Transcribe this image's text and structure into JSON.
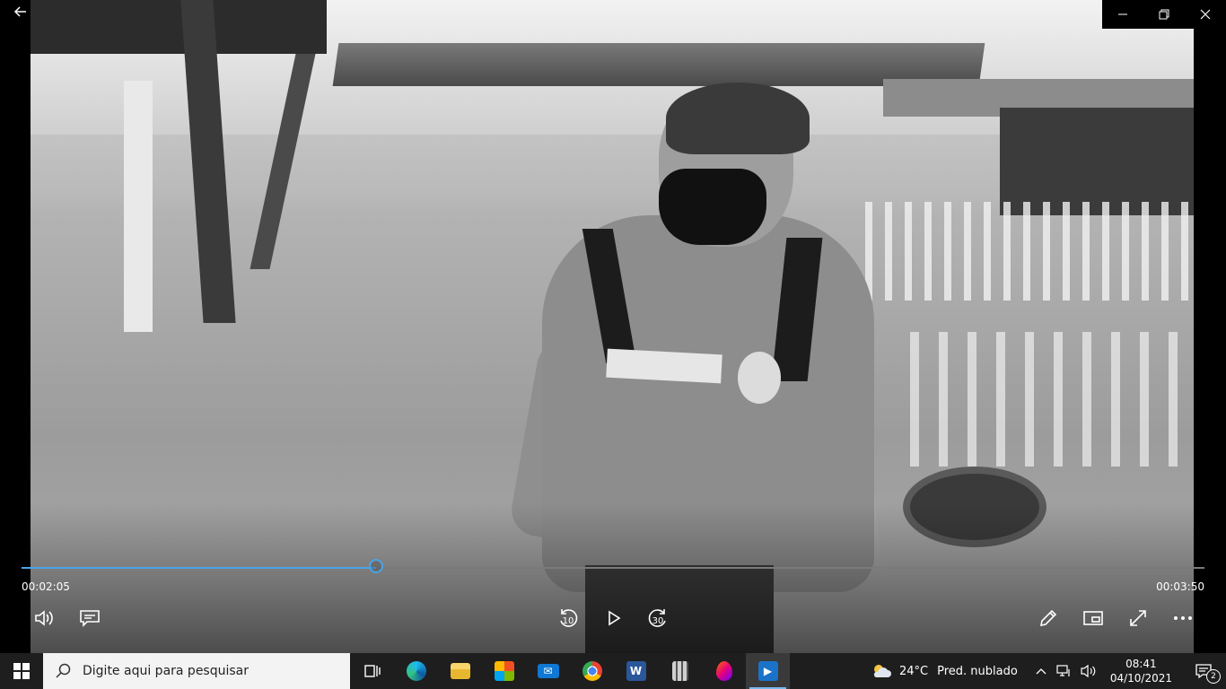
{
  "player": {
    "time_elapsed": "00:02:05",
    "time_total": "00:03:50",
    "progress_fraction": 0.3,
    "skip_back_seconds": "10",
    "skip_forward_seconds": "30",
    "accent_color": "#4aa3e8"
  },
  "window": {
    "icons": [
      "back-arrow-icon",
      "minimize-icon",
      "restore-icon",
      "close-icon"
    ]
  },
  "taskbar": {
    "search_placeholder": "Digite aqui para pesquisar",
    "apps": [
      "task-view",
      "edge",
      "file-explorer",
      "microsoft-store",
      "mail",
      "chrome",
      "word",
      "calculator",
      "paint-3d",
      "movies-and-tv"
    ]
  },
  "tray": {
    "temperature": "24°C",
    "weather": "Pred. nublado",
    "time": "08:41",
    "date": "04/10/2021",
    "notifications": "2"
  }
}
